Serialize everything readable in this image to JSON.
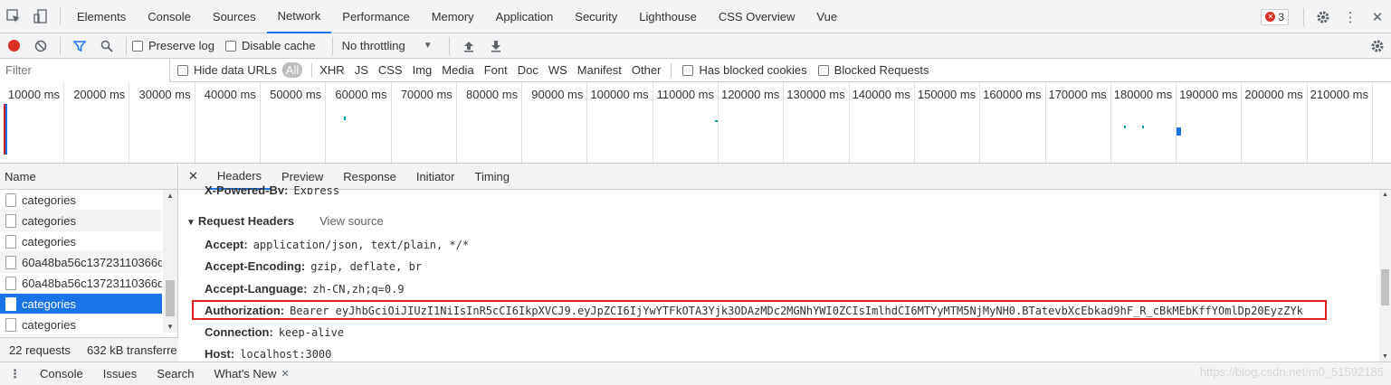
{
  "devtools_tabs": [
    "Elements",
    "Console",
    "Sources",
    "Network",
    "Performance",
    "Memory",
    "Application",
    "Security",
    "Lighthouse",
    "CSS Overview",
    "Vue"
  ],
  "active_tab": "Network",
  "error_count": "3",
  "toolbar": {
    "preserve_log": "Preserve log",
    "disable_cache": "Disable cache",
    "throttling": "No throttling"
  },
  "filterbar": {
    "placeholder": "Filter",
    "hide_data_urls": "Hide data URLs",
    "all": "All",
    "types": [
      "XHR",
      "JS",
      "CSS",
      "Img",
      "Media",
      "Font",
      "Doc",
      "WS",
      "Manifest",
      "Other"
    ],
    "blocked_cookies": "Has blocked cookies",
    "blocked_requests": "Blocked Requests"
  },
  "timeline_ticks": [
    "10000 ms",
    "20000 ms",
    "30000 ms",
    "40000 ms",
    "50000 ms",
    "60000 ms",
    "70000 ms",
    "80000 ms",
    "90000 ms",
    "100000 ms",
    "110000 ms",
    "120000 ms",
    "130000 ms",
    "140000 ms",
    "150000 ms",
    "160000 ms",
    "170000 ms",
    "180000 ms",
    "190000 ms",
    "200000 ms",
    "210000 ms",
    "220"
  ],
  "requests": {
    "header": "Name",
    "items": [
      "categories",
      "categories",
      "categories",
      "60a48ba56c13723110366d",
      "60a48ba56c13723110366d",
      "categories",
      "categories"
    ],
    "selected_index": 5
  },
  "status": {
    "requests": "22 requests",
    "transferred": "632 kB transferre"
  },
  "detail_tabs": [
    "Headers",
    "Preview",
    "Response",
    "Initiator",
    "Timing"
  ],
  "active_detail_tab": "Headers",
  "partial_header": {
    "key": "X-Powered-By:",
    "value": "Express"
  },
  "request_headers": {
    "title": "Request Headers",
    "view_source": "View source",
    "items": [
      {
        "key": "Accept:",
        "value": "application/json, text/plain, */*"
      },
      {
        "key": "Accept-Encoding:",
        "value": "gzip, deflate, br"
      },
      {
        "key": "Accept-Language:",
        "value": "zh-CN,zh;q=0.9"
      },
      {
        "key": "Authorization:",
        "value": "Bearer eyJhbGciOiJIUzI1NiIsInR5cCI6IkpXVCJ9.eyJpZCI6IjYwYTFkOTA3Yjk3ODAzMDc2MGNhYWI0ZCIsImlhdCI6MTYyMTM5NjMyNH0.BTatevbXcEbkad9hF_R_cBkMEbKffYOmlDp20EyzZYk"
      },
      {
        "key": "Connection:",
        "value": "keep-alive"
      },
      {
        "key": "Host:",
        "value": "localhost:3000"
      }
    ]
  },
  "drawer_tabs": [
    "Console",
    "Issues",
    "Search",
    "What's New"
  ],
  "watermark": "https://blog.csdn.net/m0_51592185"
}
